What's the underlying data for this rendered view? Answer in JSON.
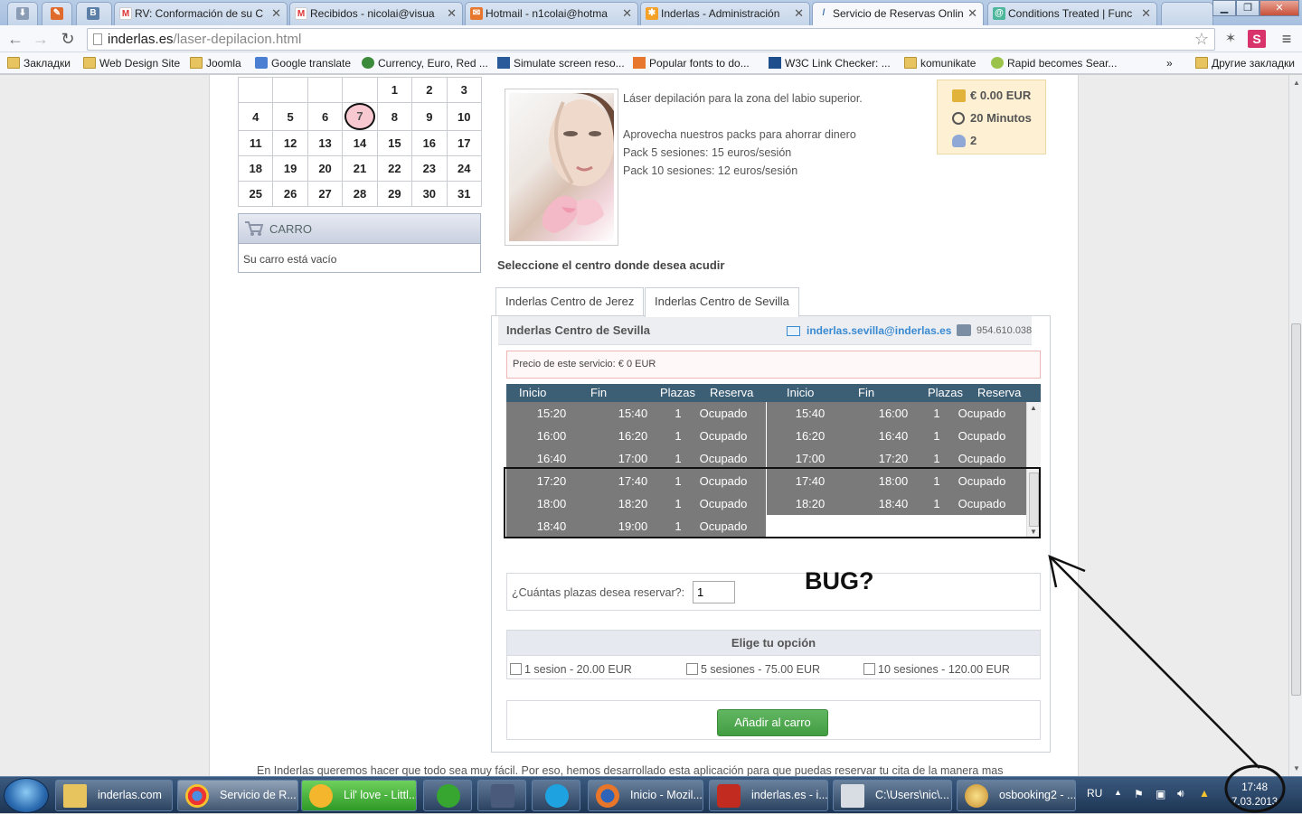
{
  "browser": {
    "tabs": [
      {
        "label": "",
        "icon": "download-icon"
      },
      {
        "label": "",
        "icon": "feed-icon"
      },
      {
        "label": "",
        "icon": "vk-icon"
      },
      {
        "label": "RV: Conformación de su C",
        "icon": "gmail-icon"
      },
      {
        "label": "Recibidos - nicolai@visua",
        "icon": "gmail-icon"
      },
      {
        "label": "Hotmail - n1colai@hotma",
        "icon": "hotmail-icon"
      },
      {
        "label": "Inderlas - Administración",
        "icon": "joomla-icon"
      },
      {
        "label": "Servicio de Reservas Onlin",
        "icon": "page-icon"
      },
      {
        "label": "Conditions Treated | Func",
        "icon": "site-icon"
      }
    ],
    "url_host": "inderlas.es",
    "url_path": "/laser-depilacion.html",
    "bookmarks": [
      "Закладки",
      "Web Design Site",
      "Joomla",
      "Google translate",
      "Currency, Euro, Red ...",
      "Simulate screen reso...",
      "Popular fonts to do...",
      "W3C Link Checker: ...",
      "komunikate",
      "Rapid becomes Sear..."
    ],
    "bookmarks_more": "»",
    "other_bookmarks": "Другие закладки"
  },
  "calendar": {
    "rows": [
      [
        "",
        "",
        "",
        "",
        "1",
        "2",
        "3"
      ],
      [
        "4",
        "5",
        "6",
        "7",
        "8",
        "9",
        "10"
      ],
      [
        "11",
        "12",
        "13",
        "14",
        "15",
        "16",
        "17"
      ],
      [
        "18",
        "19",
        "20",
        "21",
        "22",
        "23",
        "24"
      ],
      [
        "25",
        "26",
        "27",
        "28",
        "29",
        "30",
        "31"
      ]
    ],
    "today": "7"
  },
  "cart": {
    "title": "CARRO",
    "empty": "Su carro está vacío"
  },
  "service": {
    "lines": [
      "Láser depilación para la zona del labio superior.",
      "Aprovecha nuestros packs para ahorrar dinero",
      "Pack 5 sesiones: 15 euros/sesión",
      "Pack 10 sesiones: 12 euros/sesión"
    ],
    "price": "€ 0.00 EUR",
    "duration": "20 Minutos",
    "persons": "2"
  },
  "centers": {
    "heading": "Seleccione el centro donde desea acudir",
    "tabs": [
      "Inderlas Centro de Jerez",
      "Inderlas Centro de Sevilla"
    ],
    "active": "Inderlas Centro de Sevilla",
    "name": "Inderlas Centro de Sevilla",
    "email": "inderlas.sevilla@inderlas.es",
    "phone": "954.610.038",
    "price_note": "Precio de este servicio: € 0 EUR"
  },
  "slots": {
    "headers": [
      "Inicio",
      "Fin",
      "Plazas",
      "Reserva",
      "Inicio",
      "Fin",
      "Plazas",
      "Reserva"
    ],
    "left": [
      [
        "15:20",
        "15:40",
        "1",
        "Ocupado"
      ],
      [
        "16:00",
        "16:20",
        "1",
        "Ocupado"
      ],
      [
        "16:40",
        "17:00",
        "1",
        "Ocupado"
      ],
      [
        "17:20",
        "17:40",
        "1",
        "Ocupado"
      ],
      [
        "18:00",
        "18:20",
        "1",
        "Ocupado"
      ],
      [
        "18:40",
        "19:00",
        "1",
        "Ocupado"
      ]
    ],
    "right": [
      [
        "15:40",
        "16:00",
        "1",
        "Ocupado"
      ],
      [
        "16:20",
        "16:40",
        "1",
        "Ocupado"
      ],
      [
        "17:00",
        "17:20",
        "1",
        "Ocupado"
      ],
      [
        "17:40",
        "18:00",
        "1",
        "Ocupado"
      ],
      [
        "18:20",
        "18:40",
        "1",
        "Ocupado"
      ]
    ]
  },
  "booking": {
    "quantity_label": "¿Cuántas plazas desea reservar?:",
    "quantity_value": "1",
    "options_title": "Elige tu opción",
    "options": [
      "1 sesion - 20.00 EUR",
      "5 sesiones - 75.00 EUR",
      "10 sesiones - 120.00 EUR"
    ],
    "add_button": "Añadir al carro"
  },
  "footer_text": "En Inderlas queremos hacer que todo sea muy fácil. Por eso, hemos desarrollado esta aplicación para que puedas reservar tu cita de la manera mas",
  "annotation": "BUG?",
  "taskbar": {
    "items": [
      {
        "label": "inderlas.com",
        "icon": "folder-icon"
      },
      {
        "label": "Servicio de R...",
        "icon": "chrome-icon"
      },
      {
        "label": "Lil' love - Littl...",
        "icon": "aimp-icon"
      },
      {
        "label": "",
        "icon": "utorrent-icon"
      },
      {
        "label": "",
        "icon": "video-icon"
      },
      {
        "label": "",
        "icon": "skype-icon"
      },
      {
        "label": "Inicio - Mozil...",
        "icon": "firefox-icon"
      },
      {
        "label": "inderlas.es - i...",
        "icon": "filezilla-icon"
      },
      {
        "label": "C:\\Users\\nic\\...",
        "icon": "notepad-icon"
      },
      {
        "label": "osbooking2 - ...",
        "icon": "paint-icon"
      }
    ],
    "lang": "RU",
    "time": "17:48",
    "date": "7.03.2013"
  },
  "colors": {
    "slot_busy": "#7a7a7a",
    "slot_header": "#3c5f76",
    "add_button": "#4aa64a",
    "email_link": "#3a8ad1",
    "info_box": "#fdf0d3"
  }
}
